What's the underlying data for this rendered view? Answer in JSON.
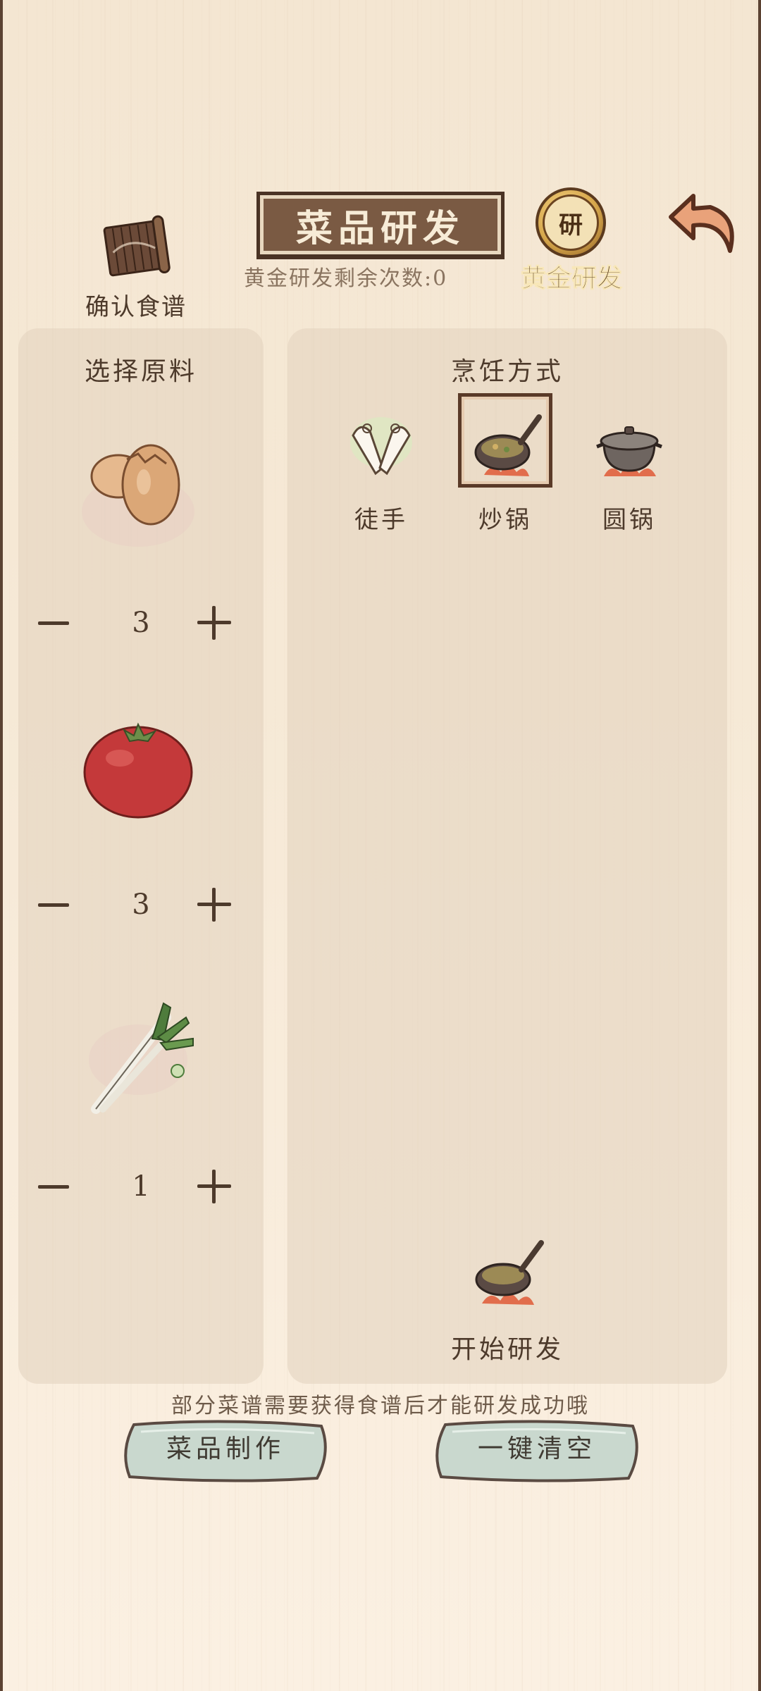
{
  "header": {
    "recipe_label": "确认食谱",
    "title": "菜品研发",
    "gold_count": "黄金研发剩余次数:0",
    "gold_label": "黄金研发",
    "gold_medal_char": "研"
  },
  "ingredients_panel": {
    "title": "选择原料",
    "items": [
      {
        "icon": "egg-icon",
        "qty": "3"
      },
      {
        "icon": "tomato-icon",
        "qty": "3"
      },
      {
        "icon": "scallion-icon",
        "qty": "1"
      }
    ]
  },
  "cooking_panel": {
    "title": "烹饪方式",
    "methods": [
      {
        "icon": "bare-hands-icon",
        "label": "徒手",
        "selected": false
      },
      {
        "icon": "wok-icon",
        "label": "炒锅",
        "selected": true
      },
      {
        "icon": "round-pot-icon",
        "label": "圆锅",
        "selected": false
      }
    ],
    "start_label": "开始研发"
  },
  "hint": "部分菜谱需要获得食谱后才能研发成功哦",
  "bottom": {
    "make_label": "菜品制作",
    "clear_label": "一键清空"
  },
  "colors": {
    "panel_bg": "#e2d2be",
    "text_dark": "#4d3a2b",
    "plaque": "#7a5a43",
    "stone_button": "#c9d8ce"
  }
}
